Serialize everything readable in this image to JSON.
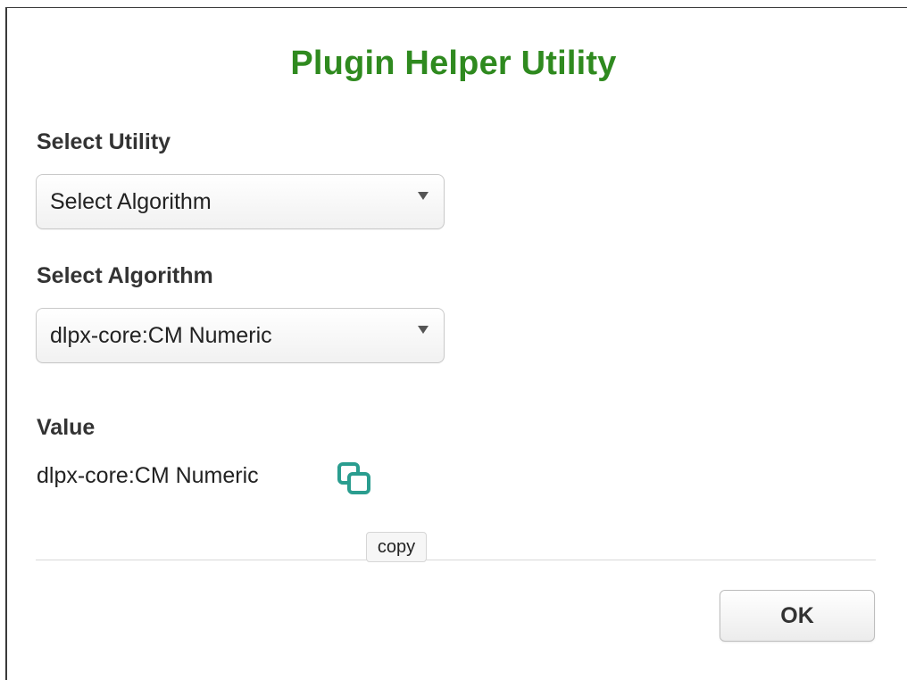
{
  "dialog": {
    "title": "Plugin Helper Utility",
    "title_color": "#2f8a1f"
  },
  "utility": {
    "label": "Select Utility",
    "selected": "Select Algorithm"
  },
  "algorithm": {
    "label": "Select Algorithm",
    "selected": "dlpx-core:CM Numeric"
  },
  "value": {
    "label": "Value",
    "text": "dlpx-core:CM Numeric",
    "copy_icon": "copy-icon",
    "copy_icon_color": "#2a9d8f"
  },
  "tooltip": {
    "text": "copy"
  },
  "footer": {
    "ok_label": "OK"
  }
}
